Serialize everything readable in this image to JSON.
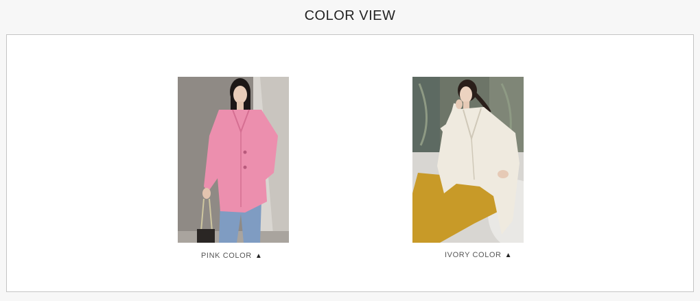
{
  "section": {
    "title": "COLOR VIEW"
  },
  "items": [
    {
      "caption": "PINK COLOR",
      "arrow": "▲",
      "garment_color": "#ec8fae",
      "photo_background": "#8f8a85"
    },
    {
      "caption": "IVORY COLOR",
      "arrow": "▲",
      "garment_color": "#efeadf",
      "skirt_color": "#c89a28",
      "photo_background": "#6d7568"
    }
  ]
}
